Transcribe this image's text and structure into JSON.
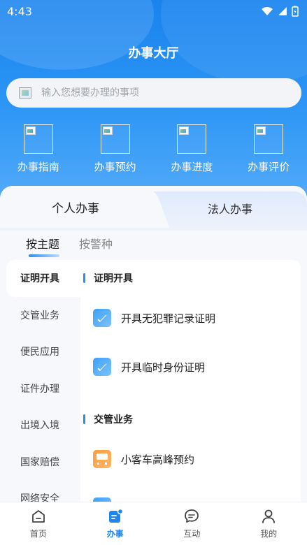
{
  "status_bar": {
    "time": "4:43"
  },
  "header": {
    "title": "办事大厅"
  },
  "search": {
    "placeholder": "输入您想要办理的事项"
  },
  "quick_actions": [
    {
      "label": "办事指南"
    },
    {
      "label": "办事预约"
    },
    {
      "label": "办事进度"
    },
    {
      "label": "办事评价"
    }
  ],
  "tabs": [
    {
      "label": "个人办事",
      "active": true
    },
    {
      "label": "法人办事",
      "active": false
    }
  ],
  "subtabs": [
    {
      "label": "按主题",
      "active": true
    },
    {
      "label": "按警种",
      "active": false
    }
  ],
  "sidebar": {
    "items": [
      {
        "label": "证明开具",
        "active": true
      },
      {
        "label": "交管业务"
      },
      {
        "label": "便民应用"
      },
      {
        "label": "证件办理"
      },
      {
        "label": "出境入境"
      },
      {
        "label": "国家赔偿"
      },
      {
        "label": "网络安全"
      }
    ]
  },
  "sections": [
    {
      "title": "证明开具",
      "items": [
        {
          "label": "开具无犯罪记录证明",
          "icon": "certificate-icon"
        },
        {
          "label": "开具临时身份证明",
          "icon": "certificate-icon"
        }
      ]
    },
    {
      "title": "交管业务",
      "items": [
        {
          "label": "小客车高峰预约",
          "icon": "bus-icon"
        }
      ]
    }
  ],
  "bottom_nav": [
    {
      "label": "首页",
      "icon": "home-icon",
      "active": false
    },
    {
      "label": "办事",
      "icon": "service-icon",
      "active": true
    },
    {
      "label": "互动",
      "icon": "chat-icon",
      "active": false
    },
    {
      "label": "我的",
      "icon": "user-icon",
      "active": false
    }
  ],
  "colors": {
    "primary": "#1e86ef",
    "hero_top": "#1a83ee",
    "hero_bottom": "#5db1fa",
    "accent_orange": "#ff9a3d"
  }
}
